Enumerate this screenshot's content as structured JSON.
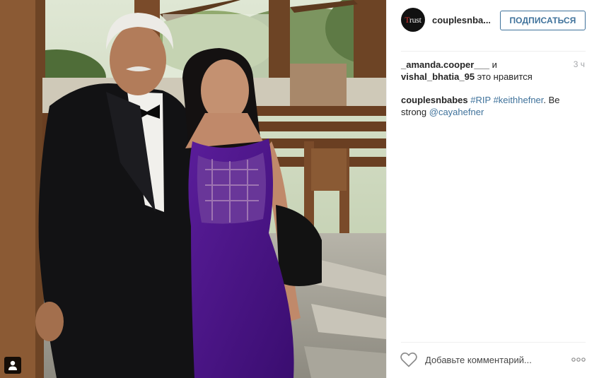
{
  "post": {
    "author": {
      "username": "couplesnba...",
      "avatar_text_first": "T",
      "avatar_text_rest": "rust"
    },
    "follow_label": "ПОДПИСАТЬСЯ",
    "time_ago": "3 ч",
    "likes": {
      "user1": "_amanda.cooper___",
      "connector": " и",
      "user2": "vishal_bhatia_95",
      "suffix": " это нравится"
    },
    "caption": {
      "user": "couplesnbabes",
      "tag1": "#RIP",
      "tag2": "#keithhefner",
      "text": ". Be strong ",
      "mention": "@cayahefner"
    },
    "comment_placeholder": "Добавьте комментарий...",
    "icons": {
      "like": "heart-outline-icon",
      "more": "ellipsis-icon",
      "tagged": "person-tag-icon"
    },
    "colors": {
      "link": "#3f729b",
      "text": "#262626",
      "muted": "#a5a7aa"
    }
  }
}
